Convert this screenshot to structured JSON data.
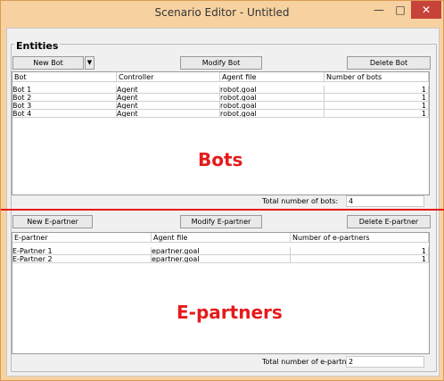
{
  "window": {
    "title": "Scenario Editor - Untitled",
    "minimize_glyph": "—",
    "maximize_glyph": "□",
    "close_glyph": "✕"
  },
  "group_label": "Entities",
  "bots": {
    "new_label": "New Bot",
    "dropdown_glyph": "▼",
    "modify_label": "Modify Bot",
    "delete_label": "Delete Bot",
    "columns": [
      "Bot",
      "Controller",
      "Agent file",
      "Number of bots"
    ],
    "rows": [
      [
        "Bot 1",
        "Agent",
        "robot.goal",
        "1"
      ],
      [
        "Bot 2",
        "Agent",
        "robot.goal",
        "1"
      ],
      [
        "Bot 3",
        "Agent",
        "robot.goal",
        "1"
      ],
      [
        "Bot 4",
        "Agent",
        "robot.goal",
        "1"
      ]
    ],
    "total_label": "Total number of bots:",
    "total_value": "4"
  },
  "epartners": {
    "new_label": "New E-partner",
    "modify_label": "Modify E-partner",
    "delete_label": "Delete E-partner",
    "columns": [
      "E-partner",
      "Agent file",
      "Number of e-partners"
    ],
    "rows": [
      [
        "E-Partner 1",
        "epartner.goal",
        "1"
      ],
      [
        "E-Partner 2",
        "epartner.goal",
        "1"
      ]
    ],
    "total_label": "Total number of e-partners:",
    "total_value": "2"
  },
  "annotations": {
    "bots": "Bots",
    "epartners": "E-partners"
  },
  "colors": {
    "annotation": "#e51b1b",
    "titlebar": "#f7d2a0",
    "close_button": "#c7433a"
  }
}
